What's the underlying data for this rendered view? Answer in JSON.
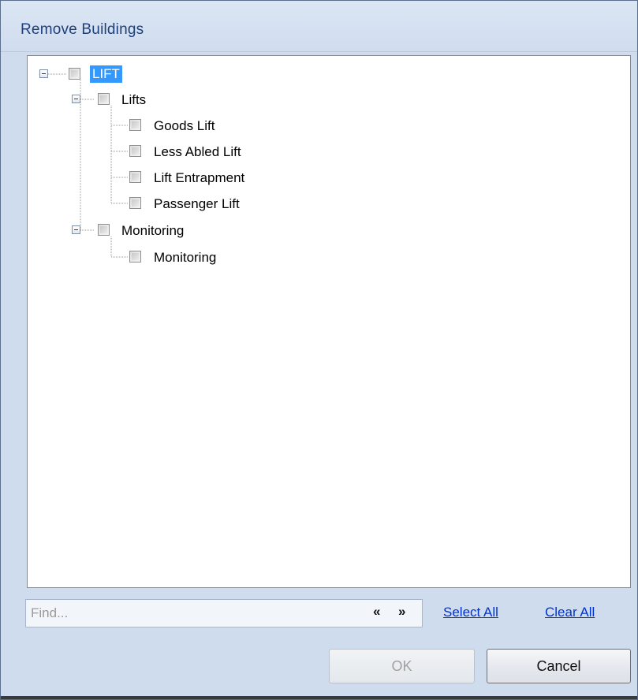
{
  "dialog": {
    "title": "Remove Buildings"
  },
  "tree": {
    "root": {
      "label": "LIFT",
      "selected": true,
      "expanded": true
    },
    "group_lifts": {
      "label": "Lifts",
      "expanded": true
    },
    "lifts_items": [
      "Goods Lift",
      "Less Abled Lift",
      "Lift Entrapment",
      "Passenger Lift"
    ],
    "group_monitoring": {
      "label": "Monitoring",
      "expanded": true
    },
    "monitoring_items": [
      "Monitoring"
    ]
  },
  "find": {
    "placeholder": "Find...",
    "prev_label": "«",
    "next_label": "»"
  },
  "actions": {
    "select_all": "Select All",
    "clear_all": "Clear All"
  },
  "buttons": {
    "ok": "OK",
    "cancel": "Cancel"
  },
  "colors": {
    "selection": "#3399ff",
    "link": "#0033cc",
    "title": "#1e3f78"
  }
}
